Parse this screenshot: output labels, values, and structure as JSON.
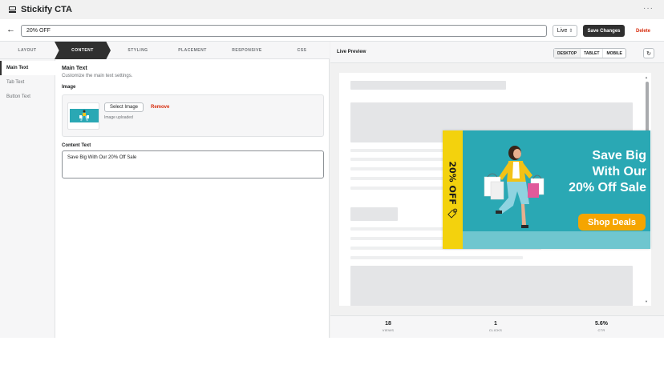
{
  "app": {
    "title": "Stickify CTA"
  },
  "titlebar": {
    "title_value": "20% OFF",
    "status": "Live",
    "save_label": "Save Changes",
    "delete_label": "Delete"
  },
  "tabs": [
    "LAYOUT",
    "CONTENT",
    "STYLING",
    "PLACEMENT",
    "RESPONSIVE",
    "CSS"
  ],
  "active_tab": "CONTENT",
  "sidebar": {
    "items": [
      "Main Text",
      "Tab Text",
      "Button Text"
    ],
    "active": "Main Text"
  },
  "main": {
    "title": "Main Text",
    "subtitle": "Customize the main text settings.",
    "image_label": "Image",
    "select_image": "Select Image",
    "remove": "Remove",
    "image_status": "Image uploaded",
    "content_label": "Content Text",
    "content_value": "Save Big With Our 20% Off Sale"
  },
  "preview": {
    "title": "Live Preview",
    "devices": [
      "DESKTOP",
      "TABLET",
      "MOBILE"
    ],
    "active_device": "DESKTOP"
  },
  "cta": {
    "tab_text": "20% OFF 🏷",
    "heading_lines": [
      "Save Big",
      "With Our",
      "20% Off Sale"
    ],
    "button": "Shop Deals",
    "colors": {
      "background": "#2aa8b4",
      "tab": "#f3d20d",
      "button": "#f5a500"
    }
  },
  "stats": [
    {
      "value": "18",
      "label": "VIEWS"
    },
    {
      "value": "1",
      "label": "CLICKS"
    },
    {
      "value": "5.6%",
      "label": "CTR"
    }
  ],
  "icons": {
    "logo": "app-logo-icon",
    "more": "more-horizontal-icon",
    "back": "arrow-left-icon",
    "status_caret": "chevron-updown-icon",
    "refresh": "refresh-icon"
  }
}
